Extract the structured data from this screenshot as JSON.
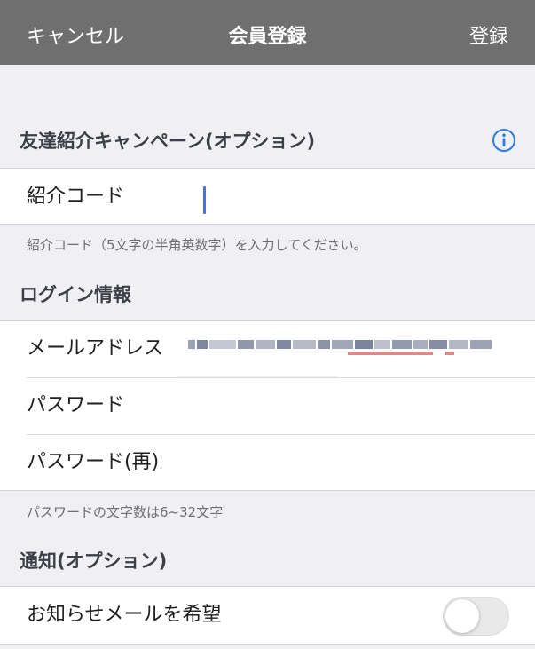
{
  "navbar": {
    "cancel_label": "キャンセル",
    "title": "会員登録",
    "register_label": "登録"
  },
  "referral": {
    "header": "友達紹介キャンペーン(オプション)",
    "info_icon": "info-circle-icon",
    "code_label": "紹介コード",
    "code_value": "",
    "note": "紹介コード（5文字の半角英数字）を入力してください。"
  },
  "login": {
    "header": "ログイン情報",
    "email_label": "メールアドレス",
    "password_label": "パスワード",
    "password_confirm_label": "パスワード(再)",
    "note": "パスワードの文字数は6~32文字"
  },
  "notifications": {
    "header": "通知(オプション)",
    "newsletter_label": "お知らせメールを希望",
    "newsletter_enabled": false
  },
  "colors": {
    "navbar_bg": "#6f6f6f",
    "background": "#efeff4",
    "accent_blue": "#2f7ce0",
    "cursor_blue": "#4f6de0"
  }
}
